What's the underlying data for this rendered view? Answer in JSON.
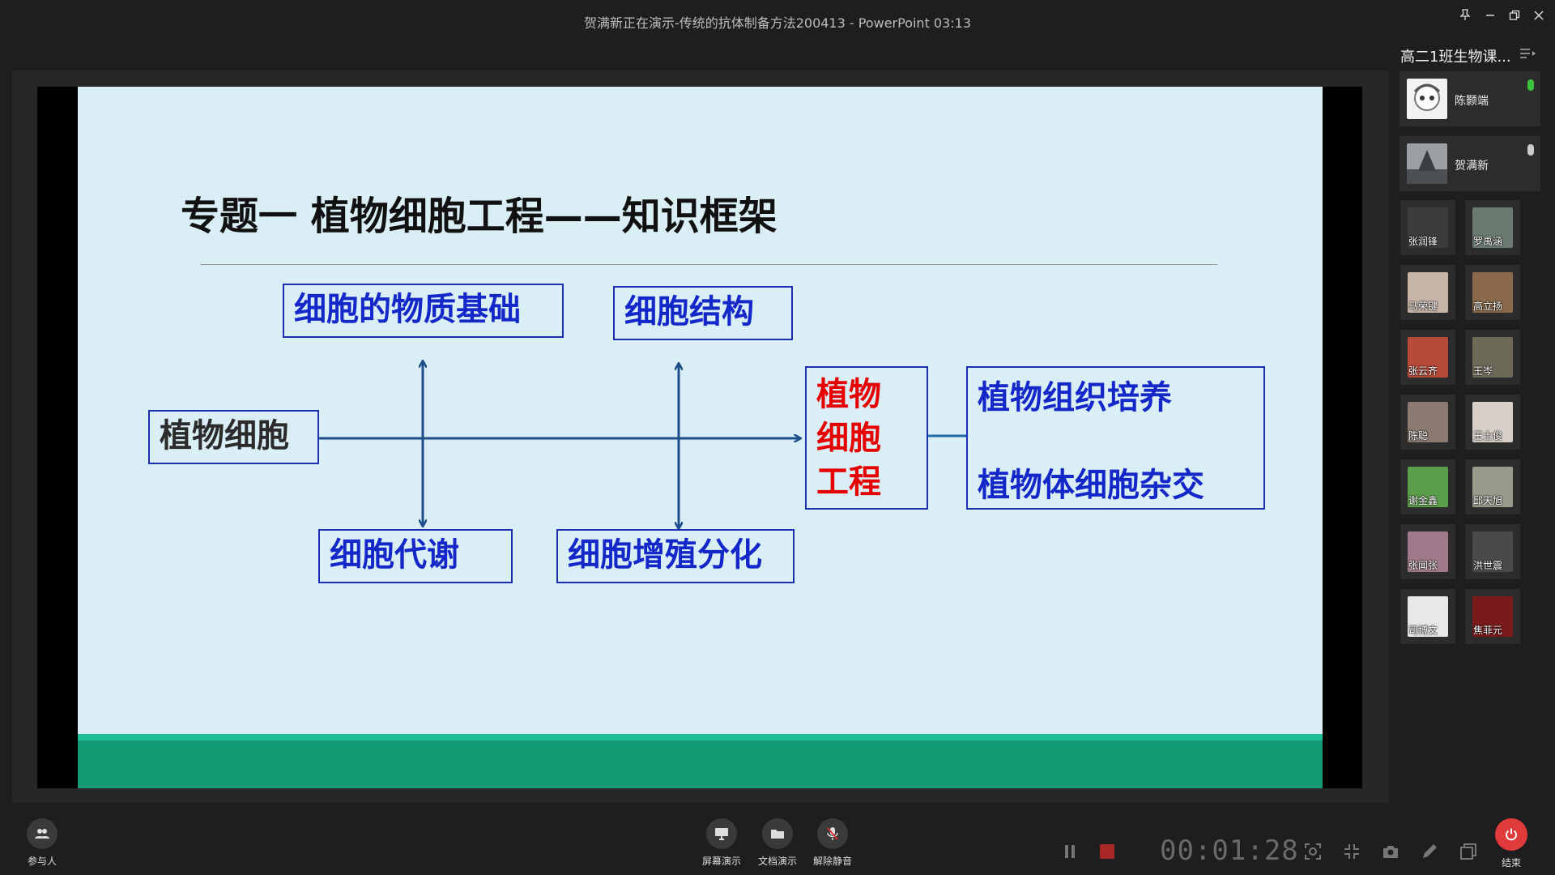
{
  "window": {
    "title": "贺满新正在演示-传统的抗体制备方法200413 - PowerPoint 03:13",
    "controls": [
      "pin-icon",
      "minimize-icon",
      "restore-icon",
      "close-icon"
    ]
  },
  "slide": {
    "title": "专题一  植物细胞工程——知识框架",
    "boxes": {
      "material": "细胞的物质基础",
      "structure": "细胞结构",
      "plant_cell": "植物细胞",
      "metabolism": "细胞代谢",
      "proliferation": "细胞增殖分化",
      "engineering": [
        "植物",
        "细胞",
        "工程"
      ],
      "tissue_culture": "植物组织培养",
      "hybridization": "植物体细胞杂交"
    },
    "colors": {
      "background": "#daeef5",
      "box_text": "#1427c8",
      "red_text": "#e60000",
      "band": "#139c74",
      "arrow": "#1c4f8a"
    }
  },
  "sidebar": {
    "room_title": "高二1班生物课...",
    "speakers": [
      {
        "name": "陈颢端",
        "mic_color": "#3cc43c"
      },
      {
        "name": "贺满新",
        "mic_color": "#cccccc"
      }
    ],
    "participants": [
      "张润锋",
      "罗禹涵",
      "马荣键",
      "高立扬",
      "张云齐",
      "王岑",
      "陈聪",
      "王士俊",
      "谢金鑫",
      "邱天旭",
      "张闻张",
      "洪世震",
      "司博文",
      "焦菲元"
    ]
  },
  "bottom": {
    "participants_label": "参与人",
    "screen_share_label": "屏幕演示",
    "doc_share_label": "文档演示",
    "unmute_label": "解除静音",
    "timer": "00:01:28",
    "end_label": "结束"
  }
}
